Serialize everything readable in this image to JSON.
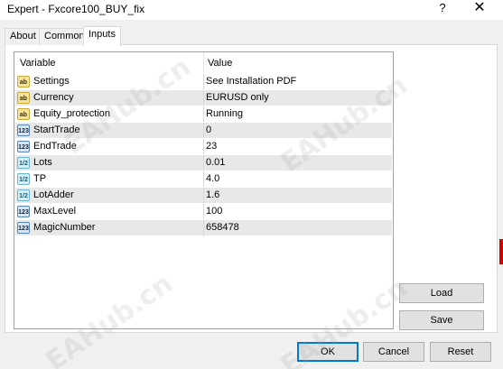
{
  "window": {
    "title": "Expert - Fxcore100_BUY_fix",
    "help_glyph": "?",
    "close_glyph": "✕"
  },
  "tabs": [
    {
      "label": "About"
    },
    {
      "label": "Common"
    },
    {
      "label": "Inputs",
      "active": true
    }
  ],
  "grid": {
    "col_variable": "Variable",
    "col_value": "Value",
    "rows": [
      {
        "icon": "string-type-icon",
        "badge": "ab",
        "name": "Settings",
        "value": "See Installation PDF"
      },
      {
        "icon": "string-type-icon",
        "badge": "ab",
        "name": "Currency",
        "value": "EURUSD only"
      },
      {
        "icon": "string-type-icon",
        "badge": "ab",
        "name": "Equity_protection",
        "value": "Running"
      },
      {
        "icon": "integer-type-icon",
        "badge": "123",
        "name": "StartTrade",
        "value": "0"
      },
      {
        "icon": "integer-type-icon",
        "badge": "123",
        "name": "EndTrade",
        "value": "23"
      },
      {
        "icon": "double-type-icon",
        "badge": "1/2",
        "name": "Lots",
        "value": "0.01"
      },
      {
        "icon": "double-type-icon",
        "badge": "1/2",
        "name": "TP",
        "value": "4.0"
      },
      {
        "icon": "double-type-icon",
        "badge": "1/2",
        "name": "LotAdder",
        "value": "1.6"
      },
      {
        "icon": "integer-type-icon",
        "badge": "123",
        "name": "MaxLevel",
        "value": "100"
      },
      {
        "icon": "integer-type-icon",
        "badge": "123",
        "name": "MagicNumber",
        "value": "658478"
      }
    ]
  },
  "buttons": {
    "load": "Load",
    "save": "Save",
    "ok": "OK",
    "cancel": "Cancel",
    "reset": "Reset"
  },
  "watermark": "EAHub.cn",
  "colors": {
    "accent": "#0078d7",
    "row_alt": "#e8e8e8",
    "string_icon": "#f5e29e",
    "int_icon": "#d6e6f7"
  }
}
